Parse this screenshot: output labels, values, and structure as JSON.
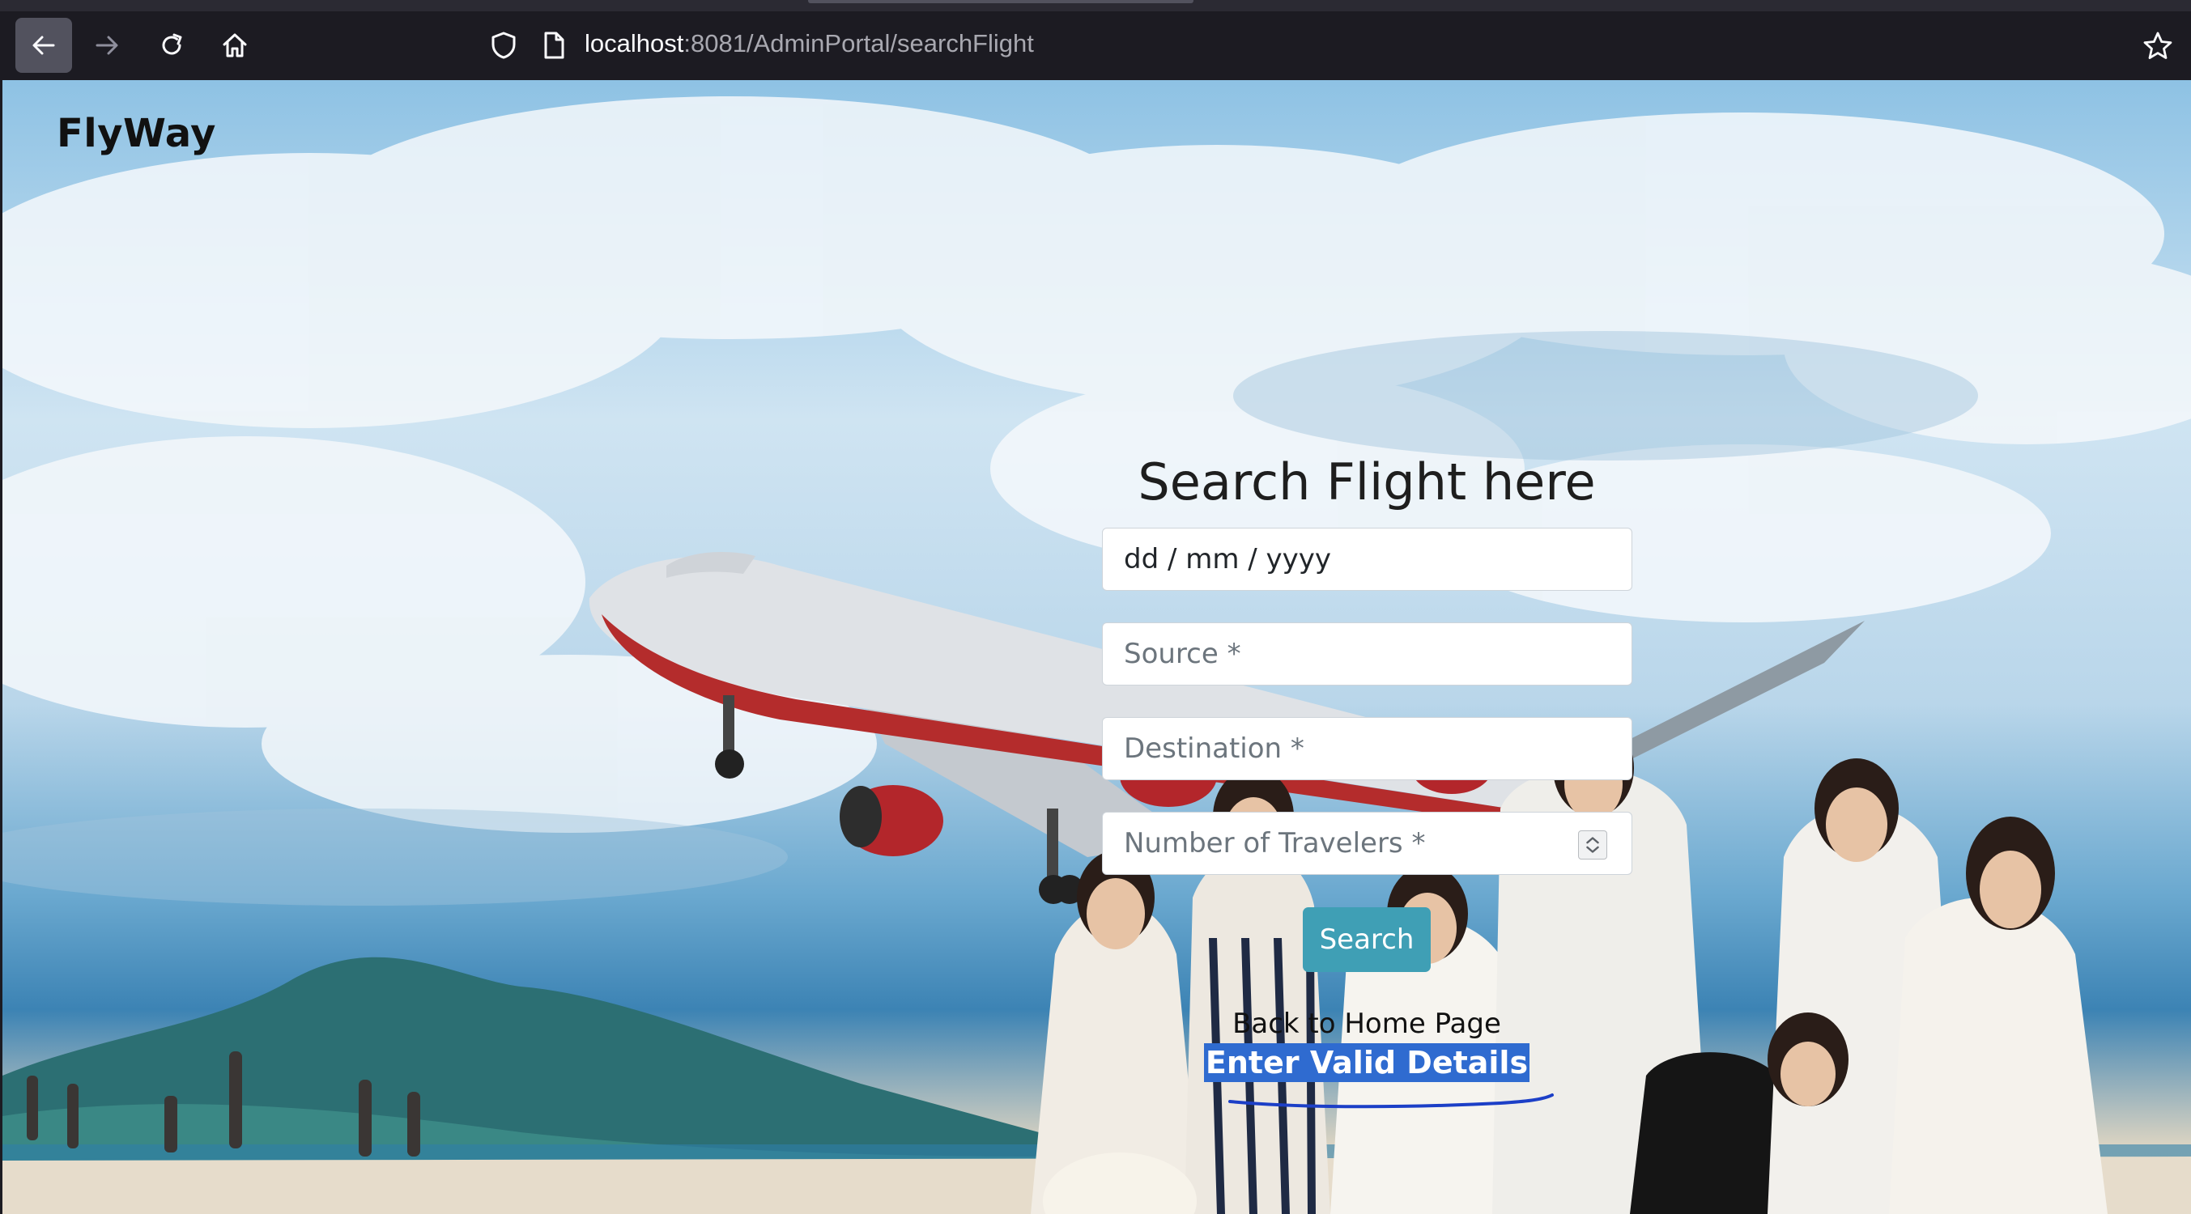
{
  "browser": {
    "url_host": "localhost",
    "url_path": ":8081/AdminPortal/searchFlight",
    "icons": [
      "back-arrow-icon",
      "forward-arrow-icon",
      "reload-icon",
      "home-icon",
      "shield-icon",
      "page-icon",
      "bookmark-star-icon"
    ]
  },
  "page": {
    "brand": "FlyWay"
  },
  "form": {
    "title": "Search Flight here",
    "date_value": "dd / mm / yyyy",
    "source_placeholder": "Source *",
    "destination_placeholder": "Destination *",
    "travelers_placeholder": "Number of Travelers *",
    "search_label": "Search",
    "home_link": "Back to Home Page",
    "error_message": "Enter Valid Details"
  },
  "colors": {
    "button": "#3f9fb5",
    "error_highlight": "#2f6bd0",
    "annotation_stroke": "#1c3fc7"
  }
}
